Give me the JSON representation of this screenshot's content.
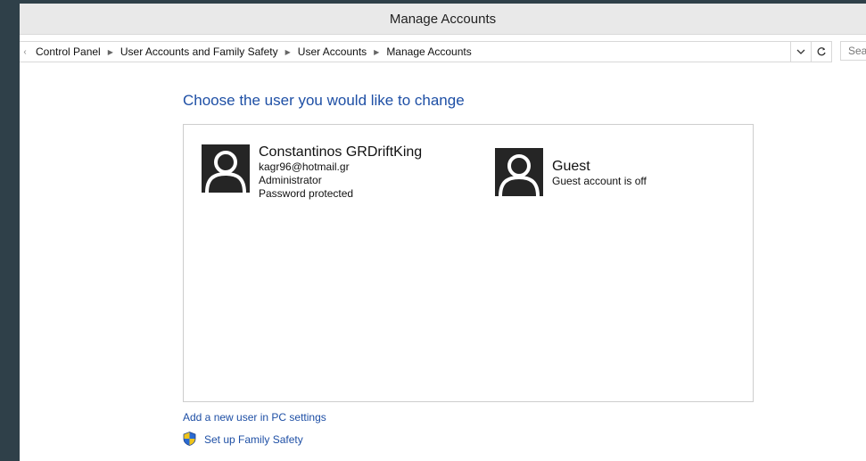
{
  "window": {
    "title": "Manage Accounts"
  },
  "breadcrumb": [
    "Control Panel",
    "User Accounts and Family Safety",
    "User Accounts",
    "Manage Accounts"
  ],
  "search": {
    "placeholder": "Sea"
  },
  "main": {
    "heading": "Choose the user you would like to change",
    "accounts": [
      {
        "name": "Constantinos GRDriftKing",
        "details": [
          "kagr96@hotmail.gr",
          "Administrator",
          "Password protected"
        ]
      },
      {
        "name": "Guest",
        "details": [
          "Guest account is off"
        ]
      }
    ],
    "add_user_link": "Add a new user in PC settings",
    "family_safety_link": "Set up Family Safety"
  },
  "icons": {
    "dropdown": "chevron-down-icon",
    "refresh": "refresh-icon",
    "avatar": "user-avatar-icon",
    "shield": "uac-shield-icon"
  },
  "colors": {
    "link": "#1e4fa5",
    "desktop": "#2f4049",
    "avatar_bg": "#252525"
  }
}
